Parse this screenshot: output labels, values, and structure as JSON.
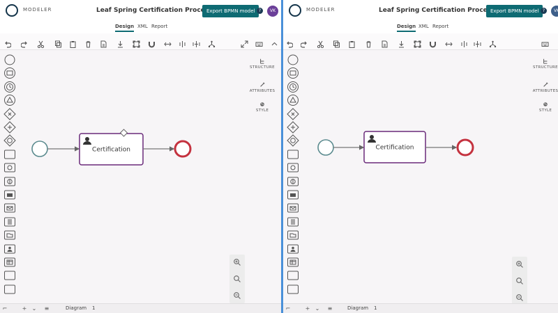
{
  "app": {
    "name": "MODELER",
    "title": "Leaf Spring Certification Process",
    "export_label": "Export BPMN model",
    "help_symbol": "?",
    "avatar_initials": "VK"
  },
  "tabs": [
    {
      "label": "Design",
      "active": true
    },
    {
      "label": "XML",
      "active": false
    },
    {
      "label": "Report",
      "active": false
    }
  ],
  "toolbar_icons": [
    "undo-icon",
    "redo-icon",
    "cut-icon",
    "copy-icon",
    "paste-icon",
    "delete-icon",
    "export-file-icon",
    "download-icon",
    "zoom-to-fit-icon",
    "magnet-icon",
    "align-icon",
    "distribute-horizontal-icon",
    "distribute-vertical-icon",
    "tree-icon",
    "expand-icon",
    "keyboard-icon",
    "collapse-icon"
  ],
  "palette_icons": [
    "start-event-icon",
    "intermediate-event-icon",
    "timer-event-icon",
    "signal-event-icon",
    "exclusive-gateway-icon",
    "parallel-gateway-icon",
    "event-gateway-icon",
    "task-icon",
    "subprocess-icon",
    "ad-hoc-icon",
    "message-task-icon",
    "send-task-icon",
    "script-task-icon",
    "data-object-icon",
    "user-task-icon",
    "business-rule-icon",
    "manual-task-icon",
    "service-task-icon"
  ],
  "side_panel": [
    {
      "label": "STRUCTURE",
      "icon": "structure-icon"
    },
    {
      "label": "ATTRIBUTES",
      "icon": "attributes-icon"
    },
    {
      "label": "STYLE",
      "icon": "style-icon"
    }
  ],
  "diagram": {
    "task_label": "Certification",
    "task_type": "user-task",
    "start_color": "#5a8a8e",
    "end_color": "#c4323f",
    "task_border": "#6a2a7a"
  },
  "bottom": {
    "diagram_label": "Diagram",
    "page_number": "1"
  },
  "colors": {
    "accent": "#0e6b73",
    "divider": "#4a90d9"
  }
}
